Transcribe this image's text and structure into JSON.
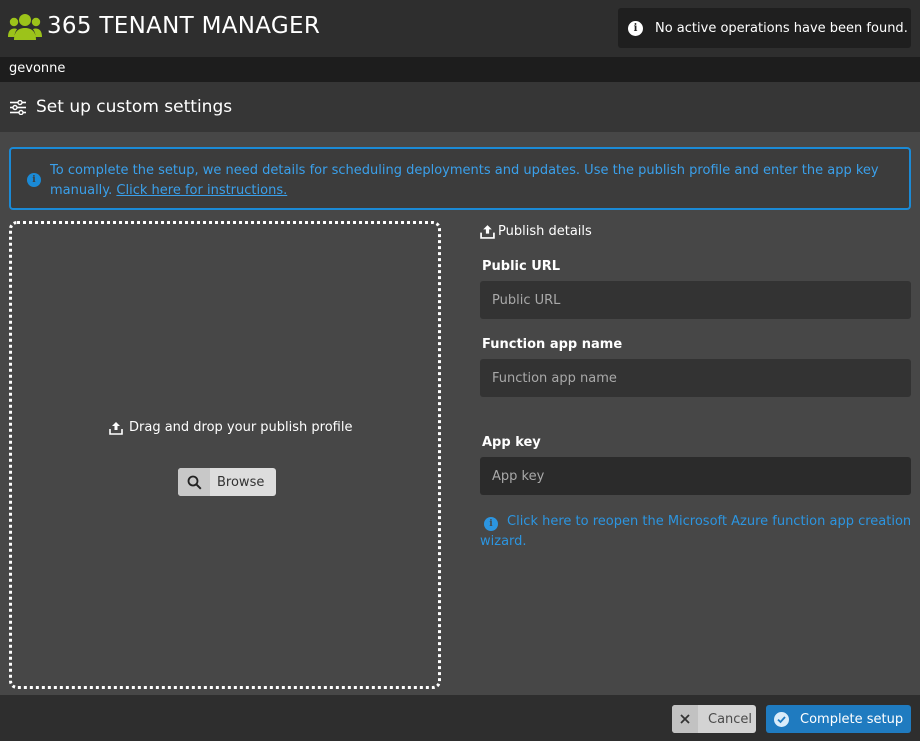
{
  "app": {
    "title": "365 TENANT MANAGER",
    "logo_icon": "users-group-icon",
    "accent_color": "#9cc31a"
  },
  "notification": {
    "icon": "info-icon",
    "text": "No active operations have been found."
  },
  "tenant": {
    "name": "gevonne"
  },
  "page": {
    "icon": "sliders-icon",
    "title": "Set up custom settings"
  },
  "banner": {
    "icon": "info-icon",
    "text": "To complete the setup, we need details for scheduling deployments and updates. Use the publish profile and enter the app key manually.",
    "link_text": "Click here for instructions.",
    "color": "#1b8ad6"
  },
  "dropzone": {
    "icon": "upload-icon",
    "label": "Drag and drop your publish profile",
    "browse_icon": "search-icon",
    "browse_label": "Browse"
  },
  "form": {
    "heading_icon": "upload-icon",
    "heading": "Publish details",
    "public_url": {
      "label": "Public URL",
      "placeholder": "Public URL",
      "value": ""
    },
    "function_app_name": {
      "label": "Function app name",
      "placeholder": "Function app name",
      "value": ""
    },
    "app_key": {
      "label": "App key",
      "placeholder": "App key",
      "value": ""
    },
    "reopen_link": "Click here to reopen the Microsoft Azure function app creation wizard."
  },
  "footer": {
    "cancel_icon": "close-icon",
    "cancel_label": "Cancel",
    "complete_icon": "check-circle-icon",
    "complete_label": "Complete setup",
    "primary_color": "#1f7bc0"
  }
}
